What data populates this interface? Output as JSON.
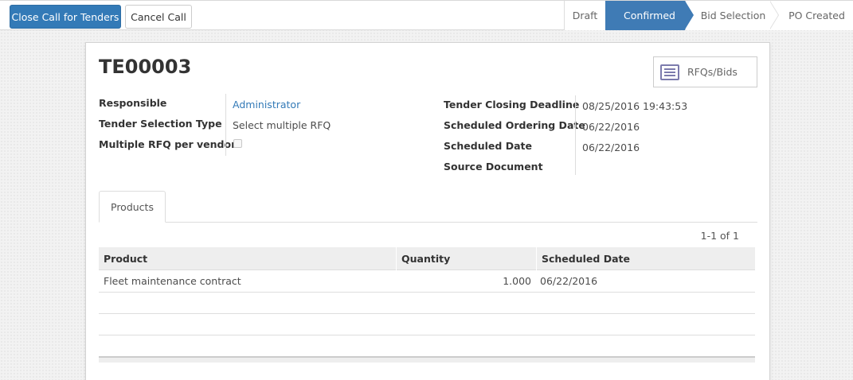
{
  "toolbar": {
    "close_call_label": "Close Call for Tenders",
    "cancel_call_label": "Cancel Call"
  },
  "statusbar": {
    "stages": [
      "Draft",
      "Confirmed",
      "Bid Selection",
      "PO Created"
    ],
    "active": "Confirmed"
  },
  "record": {
    "name": "TE00003",
    "smart_button": {
      "label": "RFQs/Bids",
      "icon": "list-icon"
    },
    "left_fields": {
      "responsible_label": "Responsible",
      "responsible_value": "Administrator",
      "selection_type_label": "Tender Selection Type",
      "selection_type_value": "Select multiple RFQ",
      "multiple_rfq_label": "Multiple RFQ per vendor",
      "multiple_rfq_checked": false
    },
    "right_fields": {
      "closing_deadline_label": "Tender Closing Deadline",
      "closing_deadline_value": "08/25/2016 19:43:53",
      "ordering_date_label": "Scheduled Ordering Date",
      "ordering_date_value": "06/22/2016",
      "scheduled_date_label": "Scheduled Date",
      "scheduled_date_value": "06/22/2016",
      "source_document_label": "Source Document",
      "source_document_value": ""
    }
  },
  "tabs": {
    "products_label": "Products"
  },
  "products": {
    "pager": "1-1 of 1",
    "columns": [
      "Product",
      "Quantity",
      "Scheduled Date"
    ],
    "rows": [
      {
        "product": "Fleet maintenance contract",
        "quantity": "1.000",
        "scheduled_date": "06/22/2016"
      }
    ]
  },
  "colors": {
    "primary": "#337ab7",
    "active_stage": "#3f7bb5",
    "icon_purple": "#7c7bad"
  }
}
